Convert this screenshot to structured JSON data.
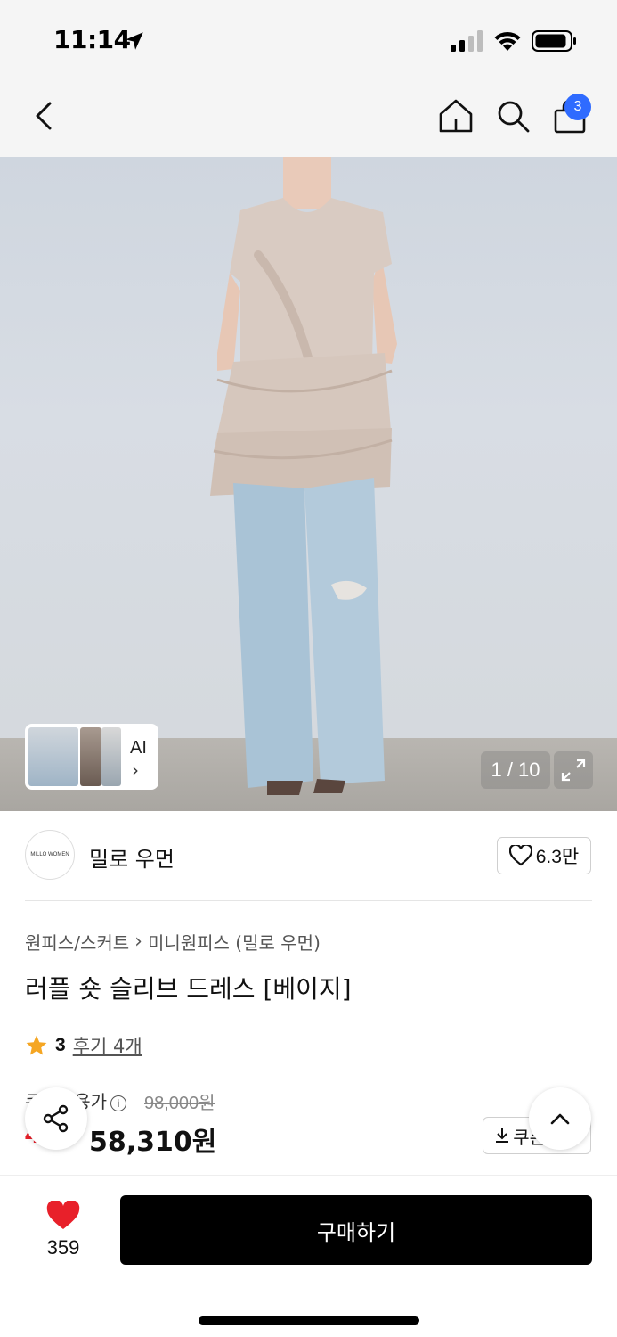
{
  "status_bar": {
    "time": "11:14"
  },
  "nav": {
    "cart_count": "3"
  },
  "gallery": {
    "thumb_label": "AI",
    "counter": "1 / 10"
  },
  "brand": {
    "logo_text": "MILLO WOMEN",
    "name": "밀로 우먼",
    "like_count": "6.3만"
  },
  "product": {
    "breadcrumb": [
      "원피스/스커트",
      "미니원피스 (밀로 우먼)"
    ],
    "title": "러플 숏 슬리브 드레스 [베이지]",
    "rating": "3",
    "review_link": "후기 4개",
    "price_label": "쿠폰적용가",
    "original_price": "98,000원",
    "discount_rate": "40%",
    "sale_price": "58,310원",
    "coupon_label": "쿠폰받기"
  },
  "bottom_bar": {
    "wish_count": "359",
    "buy_label": "구매하기"
  },
  "colors": {
    "accent": "#2f6bff",
    "discount": "#e8202a",
    "heart": "#e8202a",
    "star": "#f5a623"
  }
}
